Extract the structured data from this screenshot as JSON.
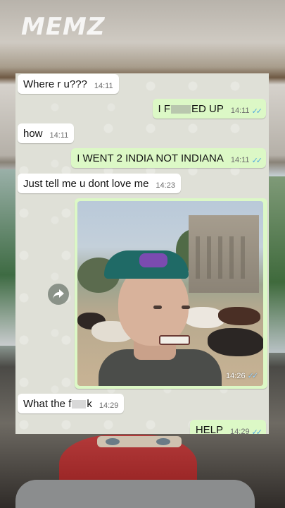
{
  "watermark": {
    "logo_text": "MEMZ"
  },
  "chat": {
    "messages": [
      {
        "text": "Where r u???",
        "time": "14:11",
        "direction": "incoming"
      },
      {
        "text_before": "I F",
        "text_after": "ED UP",
        "time": "14:11",
        "direction": "outgoing",
        "read": true
      },
      {
        "text": "how",
        "time": "14:11",
        "direction": "incoming"
      },
      {
        "text": "I WENT 2 INDIA NOT INDIANA",
        "time": "14:11",
        "direction": "outgoing",
        "read": true
      },
      {
        "text": "Just tell me u dont love me",
        "time": "14:23",
        "direction": "incoming"
      },
      {
        "type": "photo",
        "time": "14:26",
        "direction": "outgoing",
        "read": true
      },
      {
        "text_before": "What the f",
        "text_after": "k",
        "time": "14:29",
        "direction": "incoming"
      },
      {
        "text": "HELP",
        "time": "14:29",
        "direction": "outgoing",
        "read": true
      }
    ],
    "share_icon": "share-forward-icon",
    "tick_glyph": "✓✓",
    "colors": {
      "incoming": "#ffffff",
      "outgoing": "#dcf8c6",
      "tick": "#4fa8e0"
    }
  }
}
